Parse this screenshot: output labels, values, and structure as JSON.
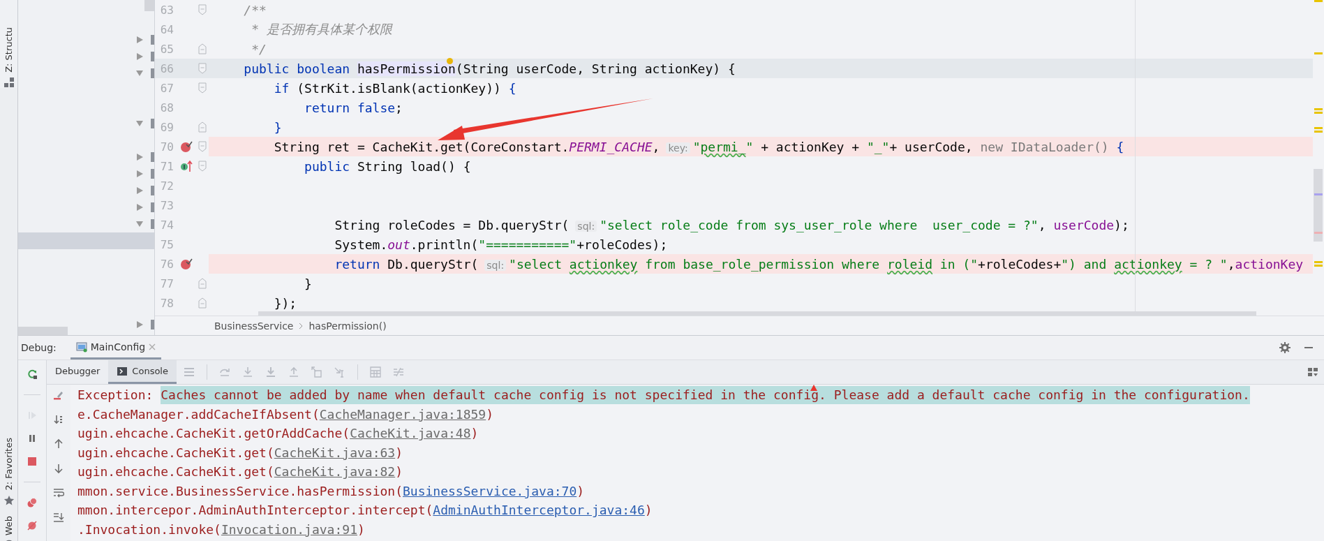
{
  "tool_stripe": [
    {
      "label": "Z: Structu",
      "kind": "structure"
    },
    {
      "label": "2: Favorites",
      "kind": "favorites"
    },
    {
      "label": "Web",
      "kind": "web"
    }
  ],
  "structure_tree": [
    {
      "kind": "node",
      "expanded": false,
      "selected": false
    },
    {
      "kind": "node",
      "expanded": false,
      "selected": false
    },
    {
      "kind": "node",
      "expanded": true,
      "selected": false
    },
    {
      "kind": "blank",
      "selected": false
    },
    {
      "kind": "blank",
      "selected": false
    },
    {
      "kind": "node",
      "expanded": true,
      "selected": false
    },
    {
      "kind": "blank",
      "selected": false
    },
    {
      "kind": "node",
      "expanded": false,
      "selected": false
    },
    {
      "kind": "node",
      "expanded": false,
      "selected": false
    },
    {
      "kind": "node",
      "expanded": false,
      "selected": false
    },
    {
      "kind": "node",
      "expanded": false,
      "selected": false
    },
    {
      "kind": "node",
      "expanded": true,
      "selected": false
    },
    {
      "kind": "blank",
      "selected": true
    },
    {
      "kind": "blank",
      "selected": false
    },
    {
      "kind": "blank",
      "selected": false
    },
    {
      "kind": "blank",
      "selected": false
    },
    {
      "kind": "blank",
      "selected": false
    },
    {
      "kind": "node",
      "expanded": false,
      "selected": false
    }
  ],
  "editor": {
    "lines": [
      {
        "number": "63",
        "fold_start": true,
        "fold_end": false,
        "caret": false,
        "breakpoint": false,
        "implements": false,
        "bulb": false,
        "segments": [
          {
            "text": "    /**",
            "kind": "comment"
          }
        ]
      },
      {
        "number": "64",
        "fold_start": false,
        "fold_end": false,
        "caret": false,
        "breakpoint": false,
        "implements": false,
        "bulb": false,
        "segments": [
          {
            "text": "     * 是否拥有具体某个权限",
            "kind": "comment"
          }
        ]
      },
      {
        "number": "65",
        "fold_start": false,
        "fold_end": true,
        "caret": false,
        "breakpoint": false,
        "implements": false,
        "bulb": false,
        "segments": [
          {
            "text": "     */",
            "kind": "comment"
          }
        ]
      },
      {
        "number": "66",
        "fold_start": true,
        "fold_end": false,
        "caret": true,
        "breakpoint": false,
        "implements": false,
        "bulb": true,
        "segments": [
          {
            "text": "    public boolean ",
            "kind": "keyword"
          },
          {
            "text": "hasPermission",
            "kind": "decl"
          },
          {
            "text": "(String userCode, String actionKey) {",
            "kind": "plain"
          }
        ]
      },
      {
        "number": "67",
        "fold_start": true,
        "fold_end": false,
        "caret": false,
        "breakpoint": false,
        "implements": false,
        "bulb": false,
        "segments": [
          {
            "text": "        if",
            "kind": "keyword"
          },
          {
            "text": " (StrKit.isBlank(actionKey)) ",
            "kind": "plain"
          },
          {
            "text": "{",
            "kind": "brace"
          }
        ]
      },
      {
        "number": "68",
        "fold_start": false,
        "fold_end": false,
        "caret": false,
        "breakpoint": false,
        "implements": false,
        "bulb": false,
        "segments": [
          {
            "text": "            return false",
            "kind": "keyword"
          },
          {
            "text": ";",
            "kind": "plain"
          }
        ]
      },
      {
        "number": "69",
        "fold_start": false,
        "fold_end": true,
        "caret": false,
        "breakpoint": false,
        "implements": false,
        "bulb": false,
        "segments": [
          {
            "text": "        }",
            "kind": "brace"
          }
        ]
      },
      {
        "number": "70",
        "fold_start": true,
        "fold_end": false,
        "caret": false,
        "breakpoint": true,
        "implements": false,
        "bulb": false,
        "segments": [
          {
            "text": "        String ret = CacheKit.get(CoreConstart.",
            "kind": "plain"
          },
          {
            "text": "PERMI_CACHE",
            "kind": "static"
          },
          {
            "text": ",",
            "kind": "plain"
          },
          {
            "text": "key:",
            "kind": "hint"
          },
          {
            "text": "\"",
            "kind": "string"
          },
          {
            "text": "permi_",
            "kind": "typo"
          },
          {
            "text": "\"",
            "kind": "string"
          },
          {
            "text": " + actionKey + ",
            "kind": "plain"
          },
          {
            "text": "\"_\"",
            "kind": "string"
          },
          {
            "text": "+ userCode, ",
            "kind": "plain"
          },
          {
            "text": "new IDataLoader() ",
            "kind": "dim"
          },
          {
            "text": "{",
            "kind": "brace"
          }
        ]
      },
      {
        "number": "71",
        "fold_start": true,
        "fold_end": false,
        "caret": false,
        "breakpoint": false,
        "implements": true,
        "bulb": false,
        "segments": [
          {
            "text": "            public",
            "kind": "keyword"
          },
          {
            "text": " String load() {",
            "kind": "plain"
          }
        ]
      },
      {
        "number": "72",
        "fold_start": false,
        "fold_end": false,
        "caret": false,
        "breakpoint": false,
        "implements": false,
        "bulb": false
      },
      {
        "number": "73",
        "fold_start": false,
        "fold_end": false,
        "caret": false,
        "breakpoint": false,
        "implements": false,
        "bulb": false
      },
      {
        "number": "74",
        "fold_start": false,
        "fold_end": false,
        "caret": false,
        "breakpoint": false,
        "implements": false,
        "bulb": false,
        "segments": [
          {
            "text": "                String roleCodes = Db.queryStr(",
            "kind": "plain"
          },
          {
            "text": "sql:",
            "kind": "hint"
          },
          {
            "text": "\"select role_code from sys_user_role where  user_code = ?\"",
            "kind": "string"
          },
          {
            "text": ", ",
            "kind": "plain"
          },
          {
            "text": "userCode",
            "kind": "param"
          },
          {
            "text": ");",
            "kind": "plain"
          }
        ]
      },
      {
        "number": "75",
        "fold_start": false,
        "fold_end": false,
        "caret": false,
        "breakpoint": false,
        "implements": false,
        "bulb": false,
        "segments": [
          {
            "text": "                System.",
            "kind": "plain"
          },
          {
            "text": "out",
            "kind": "static"
          },
          {
            "text": ".println(",
            "kind": "plain"
          },
          {
            "text": "\"===========\"",
            "kind": "string"
          },
          {
            "text": "+roleCodes);",
            "kind": "plain"
          }
        ]
      },
      {
        "number": "76",
        "fold_start": false,
        "fold_end": false,
        "caret": false,
        "breakpoint": true,
        "implements": false,
        "bulb": false,
        "segments": [
          {
            "text": "                return",
            "kind": "keyword"
          },
          {
            "text": " Db.queryStr(",
            "kind": "plain"
          },
          {
            "text": "sql:",
            "kind": "hint"
          },
          {
            "text": "\"select ",
            "kind": "string"
          },
          {
            "text": "actionkey",
            "kind": "typo"
          },
          {
            "text": " from base_role_permission where ",
            "kind": "string"
          },
          {
            "text": "roleid",
            "kind": "typo"
          },
          {
            "text": " in (\"",
            "kind": "string"
          },
          {
            "text": "+roleCodes+",
            "kind": "plain"
          },
          {
            "text": "\") and ",
            "kind": "string"
          },
          {
            "text": "actionkey",
            "kind": "typo"
          },
          {
            "text": " = ? \"",
            "kind": "string"
          },
          {
            "text": ",",
            "kind": "plain"
          },
          {
            "text": "actionKey",
            "kind": "param"
          }
        ]
      },
      {
        "number": "77",
        "fold_start": false,
        "fold_end": true,
        "caret": false,
        "breakpoint": false,
        "implements": false,
        "bulb": false,
        "segments": [
          {
            "text": "            }",
            "kind": "plain"
          }
        ]
      },
      {
        "number": "78",
        "fold_start": false,
        "fold_end": true,
        "caret": false,
        "breakpoint": false,
        "implements": false,
        "bulb": false,
        "segments": [
          {
            "text": "        });",
            "kind": "plain"
          }
        ]
      }
    ],
    "breadcrumb": [
      "BusinessService",
      "hasPermission()"
    ]
  },
  "debug": {
    "title": "Debug:",
    "tabs": [
      {
        "label": "MainConfig",
        "selected": true
      }
    ],
    "side_tools": [
      {
        "kind": "rerun",
        "disabled": false
      },
      {
        "kind": "separator"
      },
      {
        "kind": "resume",
        "disabled": true
      },
      {
        "kind": "pause",
        "disabled": false
      },
      {
        "kind": "stop",
        "disabled": false
      },
      {
        "kind": "separator"
      },
      {
        "kind": "breakpoints",
        "disabled": false
      },
      {
        "kind": "mute",
        "disabled": false
      }
    ],
    "subtabs": [
      {
        "label": "Debugger",
        "selected": false
      },
      {
        "label": "Console",
        "selected": true
      }
    ],
    "toolbar": [
      {
        "kind": "menu",
        "disabled": true
      },
      {
        "kind": "separator"
      },
      {
        "kind": "step-over",
        "disabled": true
      },
      {
        "kind": "step-into",
        "disabled": true
      },
      {
        "kind": "force-step-into",
        "disabled": true
      },
      {
        "kind": "step-out",
        "disabled": true
      },
      {
        "kind": "drop-frame",
        "disabled": true
      },
      {
        "kind": "run-to-cursor",
        "disabled": true
      },
      {
        "kind": "separator"
      },
      {
        "kind": "evaluate",
        "disabled": true
      },
      {
        "kind": "trace",
        "disabled": true
      }
    ],
    "console_tools": [
      {
        "kind": "clear"
      },
      {
        "kind": "sort"
      },
      {
        "kind": "up"
      },
      {
        "kind": "down"
      },
      {
        "kind": "wrap"
      },
      {
        "kind": "scroll-end"
      }
    ],
    "console": [
      {
        "segments": [
          {
            "text": "Exception: ",
            "kind": "plain"
          },
          {
            "text": "Caches cannot be added by name when default cache config is not specified in the config. Please add a default cache config in the configuration.",
            "kind": "highlight"
          }
        ]
      },
      {
        "segments": [
          {
            "text": "e.CacheManager.addCacheIfAbsent(",
            "kind": "plain"
          },
          {
            "text": "CacheManager.java:1859",
            "kind": "library-link"
          },
          {
            "text": ")",
            "kind": "plain"
          }
        ]
      },
      {
        "segments": [
          {
            "text": "ugin.ehcache.CacheKit.getOrAddCache(",
            "kind": "plain"
          },
          {
            "text": "CacheKit.java:48",
            "kind": "library-link"
          },
          {
            "text": ")",
            "kind": "plain"
          }
        ]
      },
      {
        "segments": [
          {
            "text": "ugin.ehcache.CacheKit.get(",
            "kind": "plain"
          },
          {
            "text": "CacheKit.java:63",
            "kind": "library-link"
          },
          {
            "text": ")",
            "kind": "plain"
          }
        ]
      },
      {
        "segments": [
          {
            "text": "ugin.ehcache.CacheKit.get(",
            "kind": "plain"
          },
          {
            "text": "CacheKit.java:82",
            "kind": "library-link"
          },
          {
            "text": ")",
            "kind": "plain"
          }
        ]
      },
      {
        "segments": [
          {
            "text": "mmon.service.BusinessService.hasPermission(",
            "kind": "plain"
          },
          {
            "text": "BusinessService.java:70",
            "kind": "project-link"
          },
          {
            "text": ")",
            "kind": "plain"
          }
        ]
      },
      {
        "segments": [
          {
            "text": "mmon.intercepor.AdminAuthInterceptor.intercept(",
            "kind": "plain"
          },
          {
            "text": "AdminAuthInterceptor.java:46",
            "kind": "project-link"
          },
          {
            "text": ")",
            "kind": "plain"
          }
        ]
      },
      {
        "segments": [
          {
            "text": ".Invocation.invoke(",
            "kind": "plain"
          },
          {
            "text": "Invocation.java:91",
            "kind": "library-link"
          },
          {
            "text": ")",
            "kind": "plain"
          }
        ]
      }
    ]
  }
}
